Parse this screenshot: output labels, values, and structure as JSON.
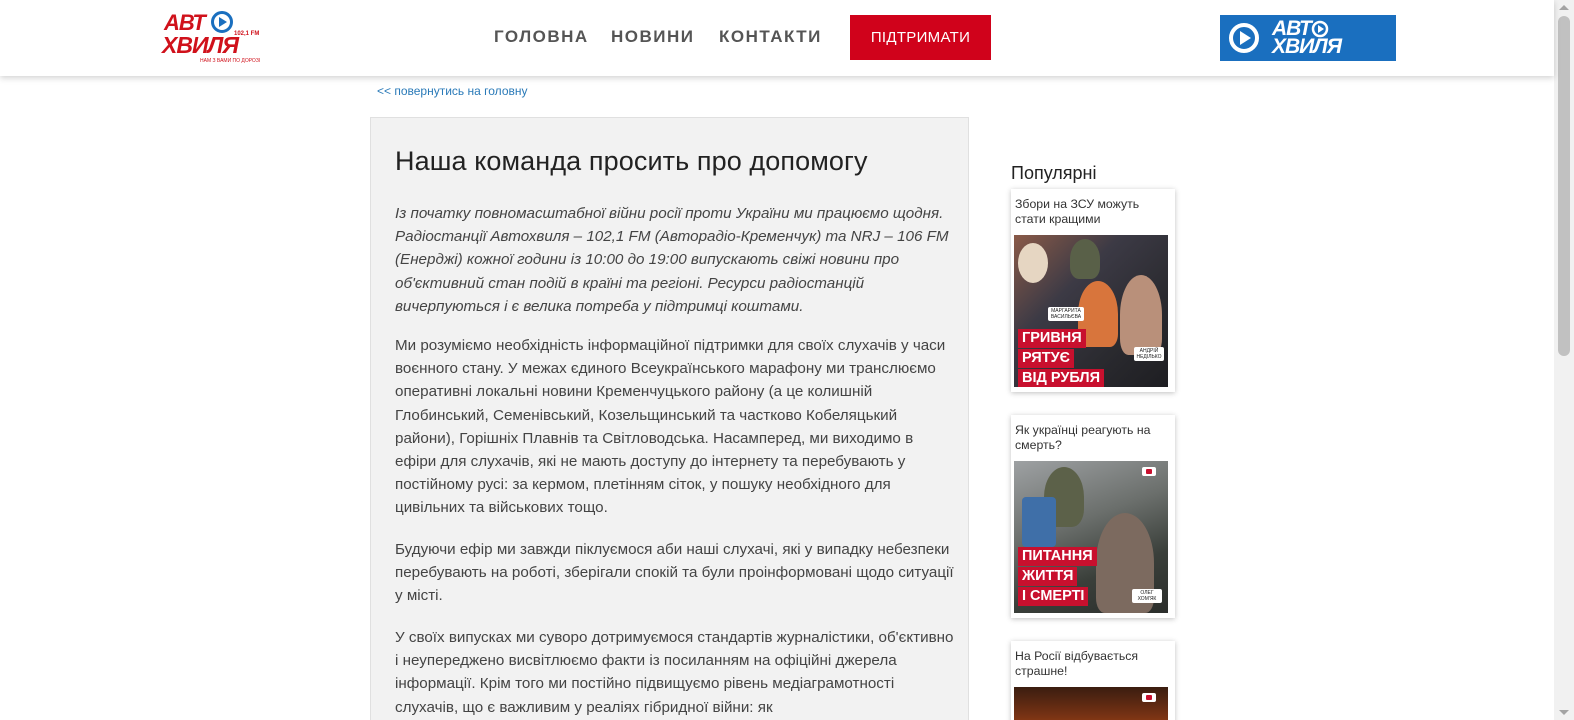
{
  "header": {
    "logo": {
      "line1": "АВТ",
      "line2": "ХВИЛЯ",
      "freq": "102,1 FM",
      "slogan": "НАМ З ВАМИ ПО ДОРОЗІ"
    },
    "nav": [
      {
        "label": "ГОЛОВНА"
      },
      {
        "label": "НОВИНИ"
      },
      {
        "label": "КОНТАКТИ"
      }
    ],
    "support_label": "ПІДТРИМАТИ",
    "menu_logo": {
      "line1": "АВТ",
      "line2": "ХВИЛЯ"
    },
    "colors": {
      "accent_red": "#d0021b",
      "brand_blue": "#1a6fbf"
    }
  },
  "back_link": "<< повернутись на головну",
  "article": {
    "title": "Наша команда просить про допомогу",
    "lead": "Із початку повномасштабної війни росії проти України ми працюємо щодня. Радіостанції Автохвиля – 102,1 FM (Авторадіо-Кременчук) та NRJ – 106 FM (Енерджі) кожної години із 10:00 до 19:00 випускають свіжі новини про об'єктивний стан подій в країні та регіоні. Ресурси радіостанцій вичерпуються і є велика потреба у підтримці коштами.",
    "paragraphs": [
      "Ми розуміємо необхідність інформаційної підтримки для своїх слухачів у часи воєнного стану. У межах єдиного Всеукраїнського марафону ми транслюємо оперативні локальні новини Кременчуцького району (а це колишній Глобинський, Семенівський, Козельщинський та частково Кобеляцький райони), Горішніх Плавнів та Світловодська. Насамперед, ми виходимо в ефіри для слухачів, які не мають доступу до інтернету та перебувають у постійному русі: за кермом, плетінням сіток, у пошуку необхідного для цивільних та військових тощо.",
      "Будуючи ефір ми завжди піклуємося аби наші слухачі, які у випадку небезпеки перебувають на роботі, зберігали спокій та були проінформовані щодо ситуації у місті.",
      "У своїх випусках ми суворо дотримуємося стандартів журналістики, об'єктивно і неупереджено висвітлюємо факти із посиланням на офіційні джерела інформації. Крім того ми постійно підвищуємо рівень медіаграмотності слухачів, що є важливим у реаліях гібридної війни: як"
    ]
  },
  "sidebar": {
    "title": "Популярні",
    "cards": [
      {
        "title": "Збори на ЗСУ можуть стати кращими",
        "headline": [
          "ГРИВНЯ",
          "РЯТУЄ",
          "ВІД РУБЛЯ"
        ],
        "names": [
          "МАРГАРИТА ВАСИЛЬЄВА",
          "АНДРІЙ НЕДІЛЬКО"
        ]
      },
      {
        "title": "Як українці реагують на смерть?",
        "headline": [
          "ПИТАННЯ",
          "ЖИТТЯ",
          "І СМЕРТІ"
        ],
        "names": [
          "ОЛЕГ ХОМ'ЯК"
        ]
      },
      {
        "title": "На Росії відбувається страшне!"
      }
    ]
  }
}
